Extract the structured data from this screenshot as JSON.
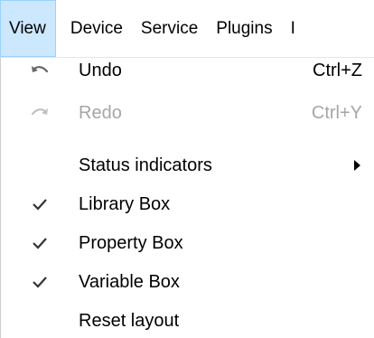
{
  "menubar": {
    "items": [
      {
        "label": "View",
        "active": true
      },
      {
        "label": "Device"
      },
      {
        "label": "Service"
      },
      {
        "label": "Plugins"
      },
      {
        "label": "I"
      }
    ]
  },
  "view_menu": {
    "undo": {
      "label": "Undo",
      "shortcut": "Ctrl+Z",
      "icon": "undo-icon"
    },
    "redo": {
      "label": "Redo",
      "shortcut": "Ctrl+Y",
      "icon": "redo-icon",
      "disabled": true
    },
    "status_indicators": {
      "label": "Status indicators",
      "has_submenu": true
    },
    "library_box": {
      "label": "Library Box",
      "checked": true
    },
    "property_box": {
      "label": "Property Box",
      "checked": true
    },
    "variable_box": {
      "label": "Variable Box",
      "checked": true
    },
    "reset_layout": {
      "label": "Reset layout"
    }
  },
  "colors": {
    "active_menu_bg": "#cce8ff",
    "active_menu_border": "#99d1ff",
    "disabled_text": "#a6a6a6"
  }
}
